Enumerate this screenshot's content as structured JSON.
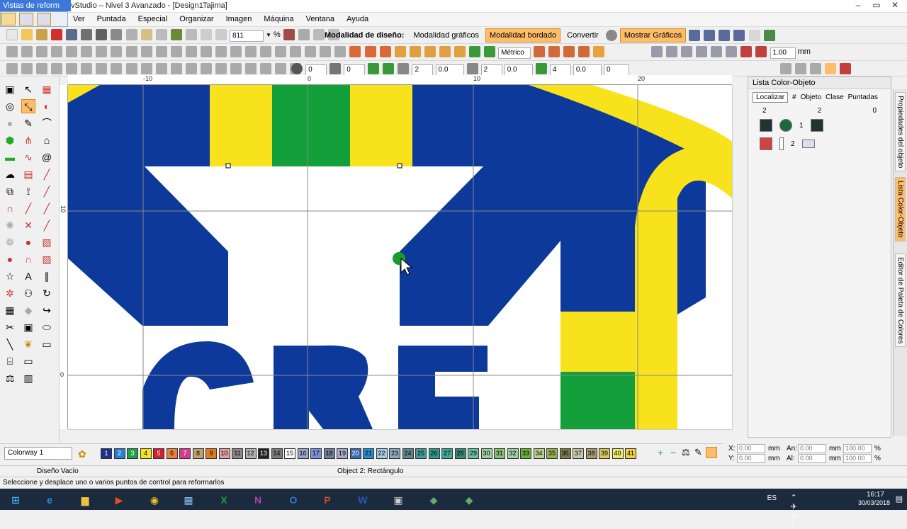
{
  "window": {
    "float_title": "Vistas de reform",
    "app_title": "vStudio – Nivel 3 Avanzado - [Design1",
    "app_subtitle": "Tajima]"
  },
  "menu": [
    "Ver",
    "Puntada",
    "Especial",
    "Organizar",
    "Imagen",
    "Máquina",
    "Ventana",
    "Ayuda"
  ],
  "toolbar1": {
    "zoom_value": "811",
    "zoom_unit": "%",
    "design_mode_label": "Modalidad de diseño:",
    "graphics_mode": "Modalidad gráficos",
    "embroidery_mode": "Modalidad bordado",
    "convert": "Convertir",
    "show_graphics": "Mostrar Gráficos"
  },
  "toolbar2": {
    "units": "Métrico",
    "scale_value": "1.00",
    "scale_unit": "mm"
  },
  "toolbar3": {
    "rotate_value": "0",
    "angle_value": "0",
    "f1": "2",
    "f2": "0.0",
    "f3": "2",
    "f4": "0.0",
    "f5": "4",
    "f6": "0.0",
    "f7": "0"
  },
  "rulers": {
    "top": [
      "-10",
      "0",
      "10",
      "20"
    ],
    "left": [
      "10",
      "0"
    ]
  },
  "panel": {
    "title": "Lista Color-Objeto",
    "locate": "Localizar",
    "col_hash": "#",
    "col_object": "Objeto",
    "col_class": "Clase",
    "col_stitches": "Puntadas",
    "counts": [
      "2",
      "2",
      "0"
    ],
    "rows": [
      {
        "num": "1"
      },
      {
        "num": "2"
      }
    ]
  },
  "sidetabs": [
    "Propiedades del objeto",
    "Lista Color-Objeto",
    "Editor de Paleta de Colores"
  ],
  "palette": {
    "colorway": "Colorway 1",
    "swatches": [
      {
        "n": "1",
        "c": "#1f2f8a"
      },
      {
        "n": "2",
        "c": "#2a7fd4"
      },
      {
        "n": "3",
        "c": "#1fa04a"
      },
      {
        "n": "4",
        "c": "#f5e21a"
      },
      {
        "n": "5",
        "c": "#d3202a"
      },
      {
        "n": "6",
        "c": "#e8803a"
      },
      {
        "n": "7",
        "c": "#d23b8e"
      },
      {
        "n": "8",
        "c": "#c0a070"
      },
      {
        "n": "9",
        "c": "#e07b1a"
      },
      {
        "n": "10",
        "c": "#e4a0a0"
      },
      {
        "n": "11",
        "c": "#8a8a8a"
      },
      {
        "n": "12",
        "c": "#b0b0b0"
      },
      {
        "n": "13",
        "c": "#222222"
      },
      {
        "n": "14",
        "c": "#7a7a7a"
      },
      {
        "n": "15",
        "c": "#ffffff"
      },
      {
        "n": "16",
        "c": "#9aa6c8"
      },
      {
        "n": "17",
        "c": "#7c8fd8"
      },
      {
        "n": "18",
        "c": "#6f7fa0"
      },
      {
        "n": "19",
        "c": "#a8a8c8"
      },
      {
        "n": "20",
        "c": "#3a6ab0"
      },
      {
        "n": "21",
        "c": "#2a8ad0"
      },
      {
        "n": "22",
        "c": "#a8c8e8"
      },
      {
        "n": "23",
        "c": "#8aa8c0"
      },
      {
        "n": "24",
        "c": "#5a8a8a"
      },
      {
        "n": "25",
        "c": "#4a9a9a"
      },
      {
        "n": "26",
        "c": "#2a9a8a"
      },
      {
        "n": "27",
        "c": "#3aaa9a"
      },
      {
        "n": "28",
        "c": "#3a8a7a"
      },
      {
        "n": "29",
        "c": "#6ac0a0"
      },
      {
        "n": "30",
        "c": "#9ad0a0"
      },
      {
        "n": "31",
        "c": "#8ac07a"
      },
      {
        "n": "32",
        "c": "#a0d0a0"
      },
      {
        "n": "33",
        "c": "#6ab03a"
      },
      {
        "n": "34",
        "c": "#b8d08a"
      },
      {
        "n": "35",
        "c": "#9ab04a"
      },
      {
        "n": "36",
        "c": "#7a7a4a"
      },
      {
        "n": "37",
        "c": "#c8c8a8"
      },
      {
        "n": "38",
        "c": "#a89a6a"
      },
      {
        "n": "39",
        "c": "#d8c85a"
      },
      {
        "n": "40",
        "c": "#f0e86a"
      },
      {
        "n": "41",
        "c": "#f0d040"
      }
    ]
  },
  "coords": {
    "x_label": "X:",
    "x_value": "0.00",
    "x_unit": "mm",
    "y_label": "Y:",
    "y_value": "0.00",
    "y_unit": "mm",
    "w_label": "An:",
    "w_value": "0.00",
    "w_unit": "mm",
    "h_label": "Al:",
    "h_value": "0.00",
    "h_unit": "mm",
    "w_pct": "100.00",
    "h_pct": "100.00",
    "pct": "%"
  },
  "status": {
    "left": "Diseño Vacío",
    "center": "Object 2: Rectángulo",
    "hint": "Seleccione y desplace uno o varios puntos de control para reformarlos"
  },
  "taskbar": {
    "lang": "ES",
    "time": "16:17",
    "date": "30/03/2018"
  },
  "colors": {
    "blue": "#0d3a9a",
    "yellow": "#f7e21c",
    "green": "#13a03a",
    "active_orange": "#fdbd6a"
  }
}
